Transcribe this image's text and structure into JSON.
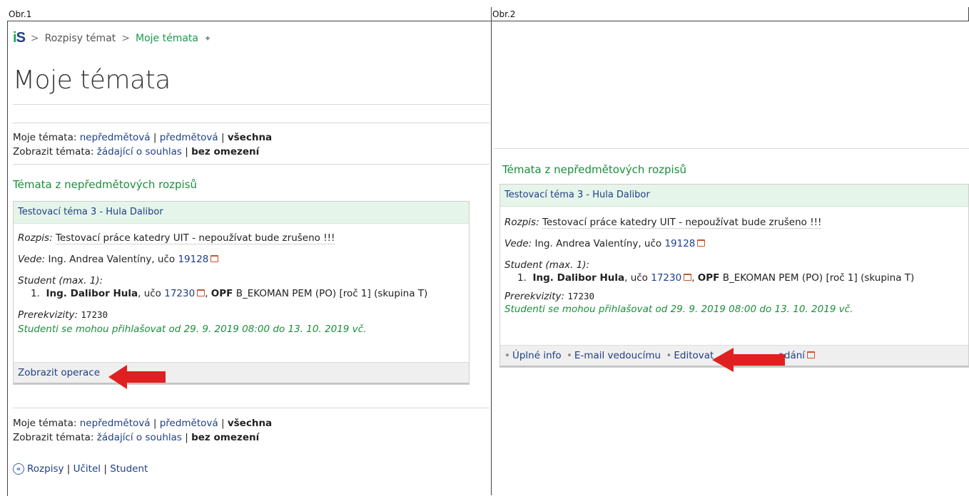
{
  "headers": {
    "left": "Obr.1",
    "right": "Obr.2"
  },
  "breadcrumb": {
    "logo_i": "i",
    "logo_s": "S",
    "sep": ">",
    "item1": "Rozpisy témat",
    "item2": "Moje témata",
    "pin": "✦"
  },
  "page_title": "Moje témata",
  "filters": {
    "mine_label": "Moje témata:",
    "mine_opt1": "nepředmětová",
    "mine_opt2": "předmětová",
    "mine_opt3": "všechna",
    "show_label": "Zobrazit témata:",
    "show_opt1": "žádající o souhlas",
    "show_opt2": "bez omezení",
    "sep": "|"
  },
  "section_title": "Témata z nepředmětových rozpisů",
  "card": {
    "title": "Testovací téma 3 - Hula Dalibor",
    "rozpis_label": "Rozpis:",
    "rozpis_value": "Testovací práce katedry UIT - nepoužívat bude zrušeno !!!",
    "vede_label": "Vede:",
    "vede_name": "Ing. Andrea Valentíny, učo",
    "vede_uco": "19128",
    "student_label": "Student (max. 1):",
    "student_num": "1.",
    "student_name": "Ing. Dalibor Hula",
    "student_uco_prefix": ", učo",
    "student_uco": "17230",
    "student_fac": "OPF",
    "student_study": "B_EKOMAN PEM (PO) [roč 1] (skupina T)",
    "prereq_label": "Prerekvizity:",
    "prereq_value": "17230",
    "note": "Studenti se mohou přihlašovat od 29. 9. 2019 08:00 do 13. 10. 2019 vč."
  },
  "left_footer": {
    "show_ops": "Zobrazit operace"
  },
  "right_footer": {
    "op1": "Úplné info",
    "op2": "E-mail vedoucímu",
    "op3": "Editovat",
    "op4_tail": "adání",
    "bullet": "•"
  },
  "bottom_nav": {
    "link1": "Rozpisy",
    "link2": "Učitel",
    "link3": "Student",
    "back_icon": "«"
  },
  "colors": {
    "arrow": "#e02020",
    "green": "#1a8f3c",
    "link": "#1f3f87",
    "card_head": "#e6f5ea"
  }
}
